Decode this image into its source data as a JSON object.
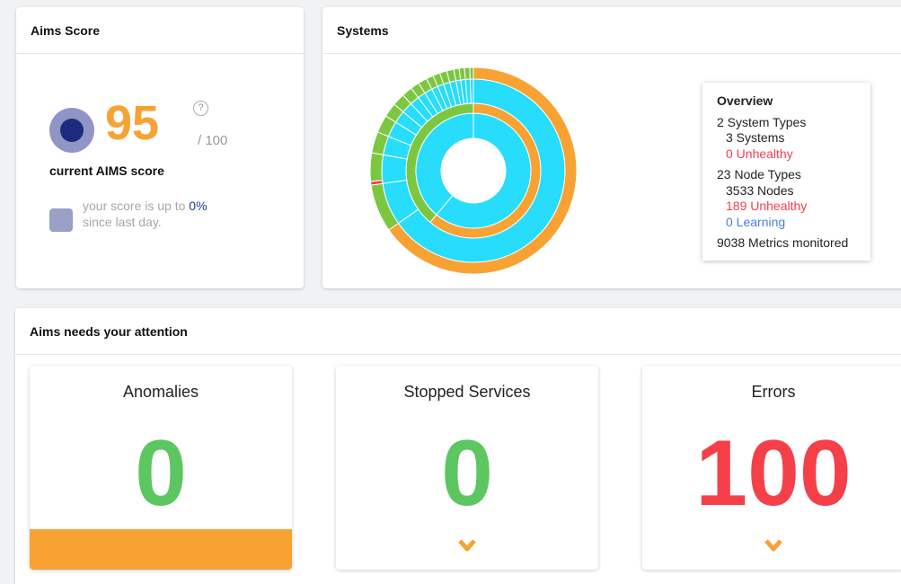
{
  "aims_score": {
    "title": "Aims Score",
    "score": "95",
    "help": "?",
    "max": "/ 100",
    "caption": "current AIMS score",
    "trend_prefix": "your score is up to ",
    "trend_value": "0%",
    "trend_suffix": "since last day.",
    "colors": {
      "score": "#f7a233",
      "dot_outer": "#8f96c6",
      "dot_inner": "#1d2a7e"
    }
  },
  "systems": {
    "title": "Systems",
    "colors": {
      "cyan": "#28dcfb",
      "orange": "#f7a233",
      "green": "#7cc73f",
      "red": "#f33d4d"
    },
    "overview": {
      "title": "Overview",
      "system_types": "2 System Types",
      "systems": "3 Systems",
      "systems_unhealthy": "0 Unhealthy",
      "node_types": "23 Node Types",
      "nodes": "3533 Nodes",
      "nodes_unhealthy": "189 Unhealthy",
      "nodes_learning": "0 Learning",
      "metrics": "9038 Metrics monitored"
    }
  },
  "attention": {
    "title": "Aims needs your attention",
    "cards": [
      {
        "label": "Anomalies",
        "value": "0",
        "status_color": "#5cc661",
        "indicator": "bar"
      },
      {
        "label": "Stopped Services",
        "value": "0",
        "status_color": "#5cc661",
        "indicator": "chevron-down-icon"
      },
      {
        "label": "Errors",
        "value": "100",
        "status_color": "#f5404a",
        "indicator": "chevron-down-icon"
      }
    ]
  }
}
